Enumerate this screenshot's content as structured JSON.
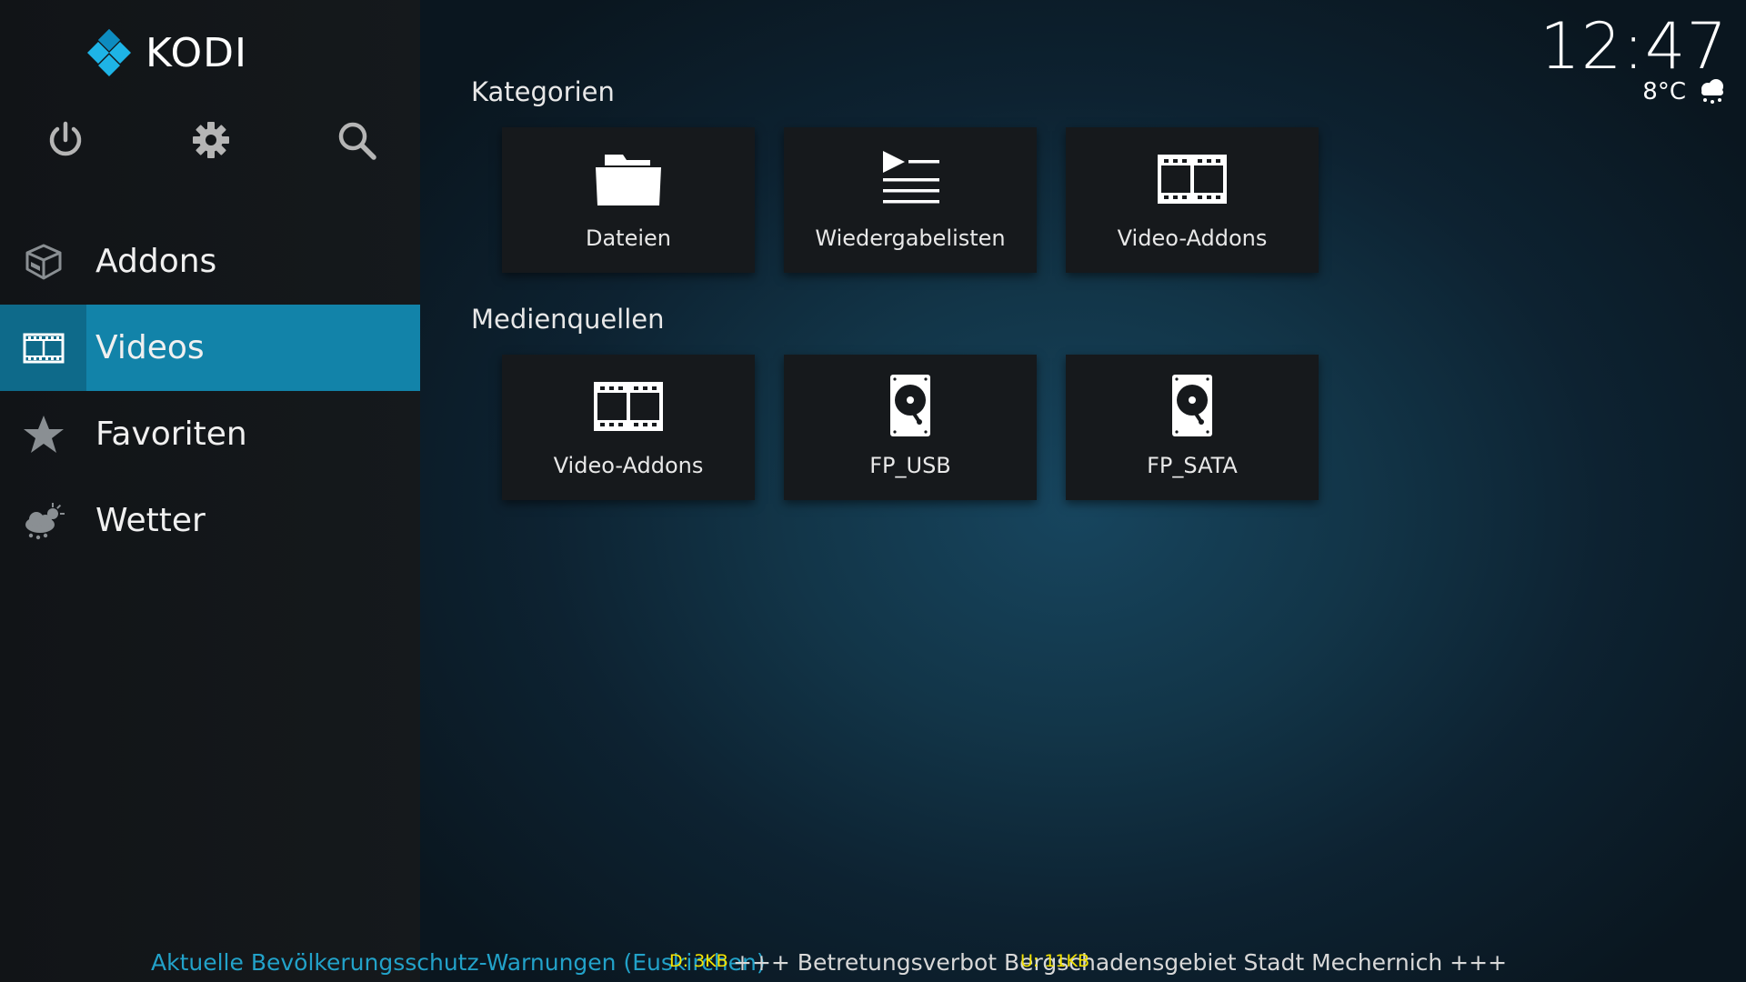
{
  "app": {
    "name": "KODI"
  },
  "sidebar": {
    "top_icons": [
      {
        "icon": "power-icon"
      },
      {
        "icon": "gear-icon"
      },
      {
        "icon": "search-icon"
      }
    ],
    "items": [
      {
        "label": "Addons",
        "icon": "addons-box-icon",
        "active": false
      },
      {
        "label": "Videos",
        "icon": "film-icon",
        "active": true
      },
      {
        "label": "Favoriten",
        "icon": "star-icon",
        "active": false
      },
      {
        "label": "Wetter",
        "icon": "weather-icon",
        "active": false
      }
    ]
  },
  "clock": {
    "time": "12:47",
    "temperature": "8°C",
    "weather_icon": "snow-cloud-icon"
  },
  "main": {
    "categories": {
      "title": "Kategorien",
      "tiles": [
        {
          "label": "Dateien",
          "icon": "folder-icon"
        },
        {
          "label": "Wiedergabelisten",
          "icon": "playlist-icon"
        },
        {
          "label": "Video-Addons",
          "icon": "film-icon"
        }
      ]
    },
    "sources": {
      "title": "Medienquellen",
      "tiles": [
        {
          "label": "Video-Addons",
          "icon": "film-icon"
        },
        {
          "label": "FP_USB",
          "icon": "hard-drive-icon"
        },
        {
          "label": "FP_SATA",
          "icon": "hard-drive-icon"
        }
      ]
    }
  },
  "ticker": {
    "label": "Aktuelle Bevölkerungsschutz-Warnungen (Euskirchen)",
    "message": "+++ Betretungsverbot Bergschadensgebiet Stadt Mechernich +++"
  },
  "network": {
    "down": "D: 3KB",
    "up": "U: 11KB"
  },
  "colors": {
    "accent": "#1283a9",
    "accent_dark": "#0e6a8a",
    "ticker_label": "#22a2c9",
    "net_stats": "#f5e300"
  }
}
